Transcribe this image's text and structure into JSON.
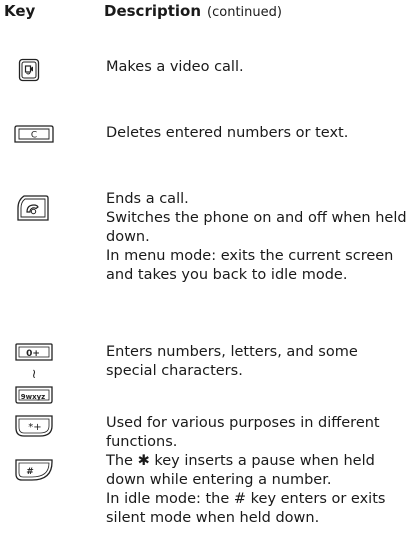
{
  "header": {
    "key_label": "Key",
    "description_label": "Description",
    "continued": "(continued)"
  },
  "rows": [
    {
      "icon": "video-call-key-icon",
      "lines": [
        "Makes a video call."
      ]
    },
    {
      "icon": "clear-key-icon",
      "key_text": "C",
      "lines": [
        "Deletes entered numbers or text."
      ]
    },
    {
      "icon": "end-call-key-icon",
      "lines": [
        "Ends a call.",
        "Switches the phone on and off when held down.",
        "In menu mode: exits the current screen and takes you back to idle mode."
      ]
    },
    {
      "icon": "alphanumeric-keys-icon",
      "key_top_text": "0+",
      "key_bottom_text": "9wxyz",
      "range_symbol": "≀",
      "lines": [
        "Enters numbers, letters, and some special characters."
      ]
    },
    {
      "icon": "star-hash-keys-icon",
      "star_key_text": "*+",
      "hash_key_text": "#",
      "lines": [
        "Used for various purposes in different functions.",
        "The ✱ key inserts a pause when held down while entering a number.",
        "In idle mode: the # key enters or exits silent mode when held down."
      ]
    }
  ]
}
